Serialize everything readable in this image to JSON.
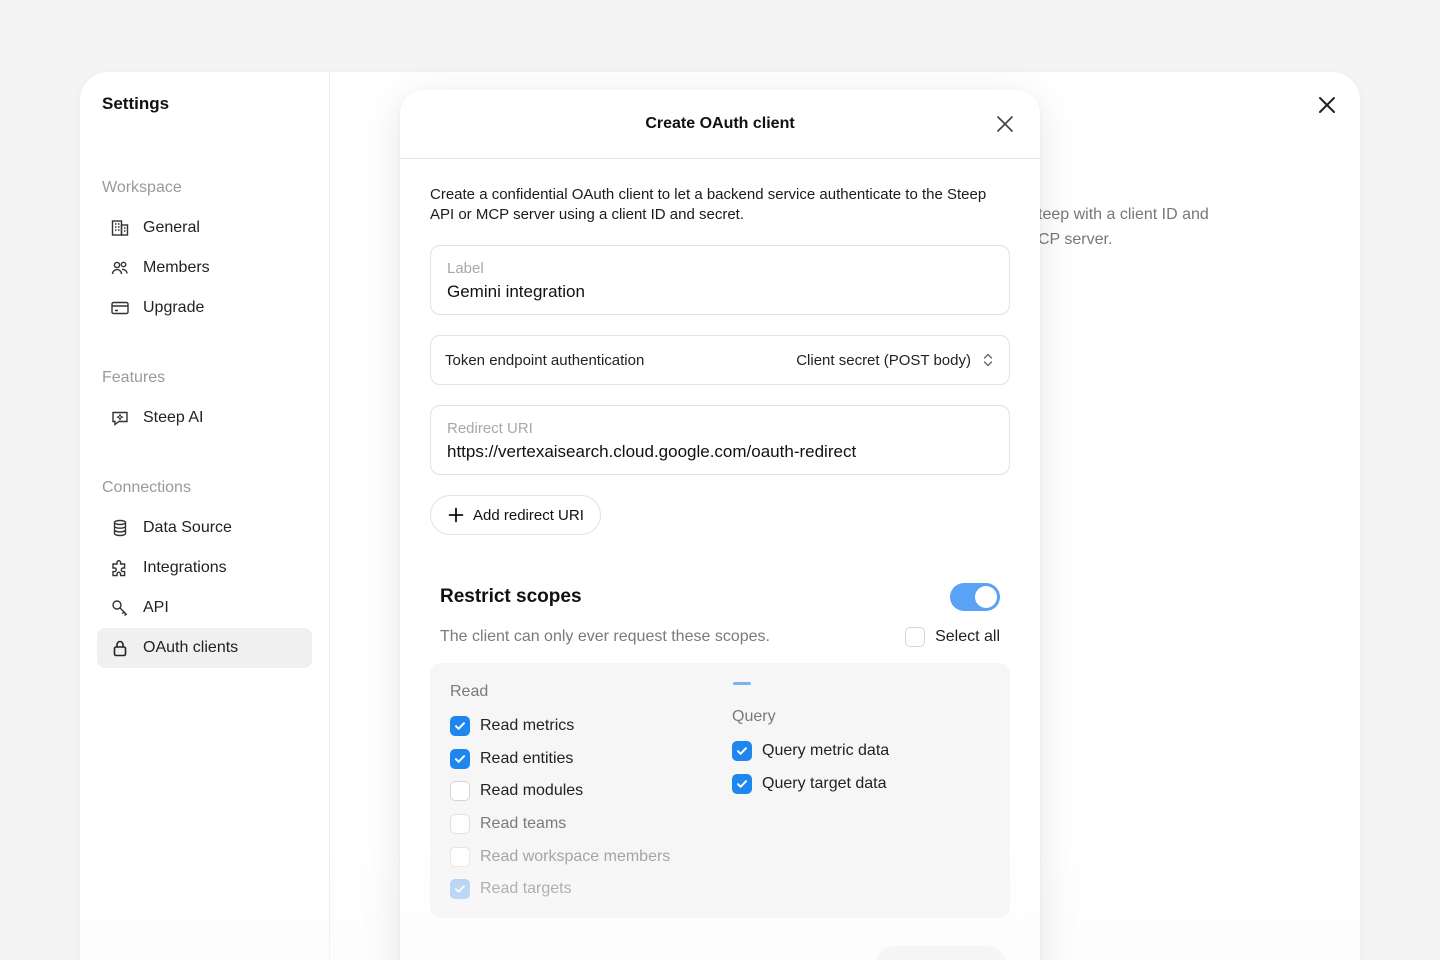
{
  "settings": {
    "title": "Settings",
    "background_description": "teep with a client ID and\nCP server.",
    "sections": [
      {
        "label": "Workspace",
        "items": [
          {
            "label": "General",
            "icon": "building-icon"
          },
          {
            "label": "Members",
            "icon": "members-icon"
          },
          {
            "label": "Upgrade",
            "icon": "credit-card-icon"
          }
        ]
      },
      {
        "label": "Features",
        "items": [
          {
            "label": "Steep AI",
            "icon": "chat-sparkle-icon"
          }
        ]
      },
      {
        "label": "Connections",
        "items": [
          {
            "label": "Data Source",
            "icon": "database-icon"
          },
          {
            "label": "Integrations",
            "icon": "puzzle-icon"
          },
          {
            "label": "API",
            "icon": "api-key-icon"
          },
          {
            "label": "OAuth clients",
            "icon": "lock-icon",
            "active": true
          }
        ]
      }
    ]
  },
  "modal": {
    "title": "Create OAuth client",
    "intro": "Create a confidential OAuth client to let a backend service authenticate to the Steep API or MCP server using a client ID and secret.",
    "label_field": {
      "label": "Label",
      "value": "Gemini integration"
    },
    "token_auth": {
      "label": "Token endpoint authentication",
      "value": "Client secret (POST body)"
    },
    "redirect_field": {
      "label": "Redirect URI",
      "value": "https://vertexaisearch.cloud.google.com/oauth-redirect"
    },
    "add_redirect_label": "Add redirect URI",
    "scopes": {
      "title": "Restrict scopes",
      "enabled": true,
      "description": "The client can only ever request these scopes.",
      "select_all_label": "Select all",
      "groups": [
        {
          "label": "Read",
          "items": [
            {
              "label": "Read metrics",
              "checked": true
            },
            {
              "label": "Read entities",
              "checked": true
            },
            {
              "label": "Read modules",
              "checked": false
            },
            {
              "label": "Read teams",
              "checked": false
            },
            {
              "label": "Read workspace members",
              "checked": false
            },
            {
              "label": "Read targets",
              "checked": true
            }
          ]
        },
        {
          "label": "Query",
          "items": [
            {
              "label": "Query metric data",
              "checked": true
            },
            {
              "label": "Query target data",
              "checked": true
            }
          ]
        }
      ]
    }
  },
  "colors": {
    "accent": "#1e86ef",
    "toggle": "#5aa2f5"
  }
}
